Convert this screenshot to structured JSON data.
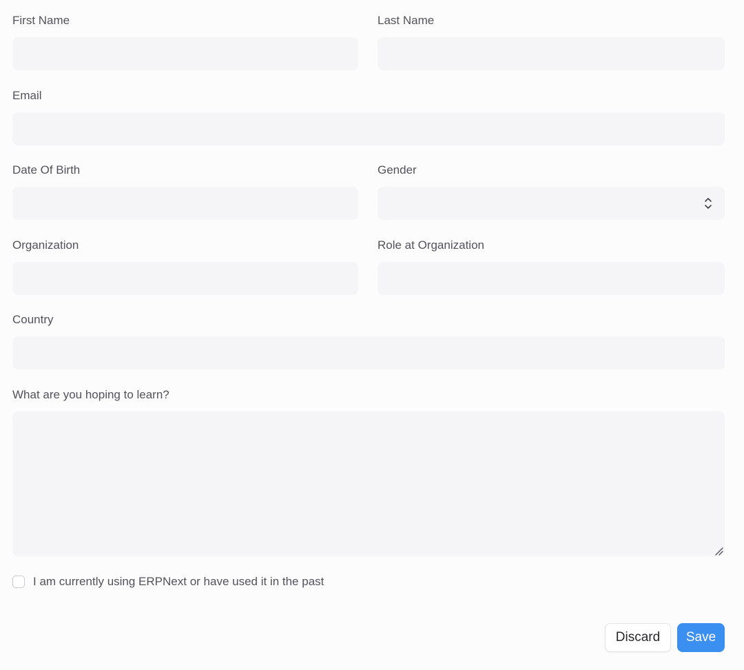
{
  "form": {
    "first_name": {
      "label": "First Name",
      "value": "",
      "placeholder": ""
    },
    "last_name": {
      "label": "Last Name",
      "value": "",
      "placeholder": ""
    },
    "email": {
      "label": "Email",
      "value": "",
      "placeholder": ""
    },
    "date_of_birth": {
      "label": "Date Of Birth",
      "value": "",
      "placeholder": ""
    },
    "gender": {
      "label": "Gender",
      "selected": "",
      "icon": "select-arrows-icon"
    },
    "organization": {
      "label": "Organization",
      "value": "",
      "placeholder": ""
    },
    "role_at_organization": {
      "label": "Role at Organization",
      "value": "",
      "placeholder": ""
    },
    "country": {
      "label": "Country",
      "value": "",
      "placeholder": ""
    },
    "learning_goals": {
      "label": "What are you hoping to learn?",
      "value": "",
      "placeholder": ""
    },
    "erpnext_checkbox": {
      "label": "I am currently using ERPNext or have used it in the past",
      "checked": false
    }
  },
  "actions": {
    "discard_label": "Discard",
    "save_label": "Save"
  },
  "colors": {
    "background": "#fdfcfd",
    "input_background": "#f5f4f7",
    "label_text": "#52525b",
    "primary_button": "#3b8ff0",
    "primary_button_text": "#ffffff"
  }
}
